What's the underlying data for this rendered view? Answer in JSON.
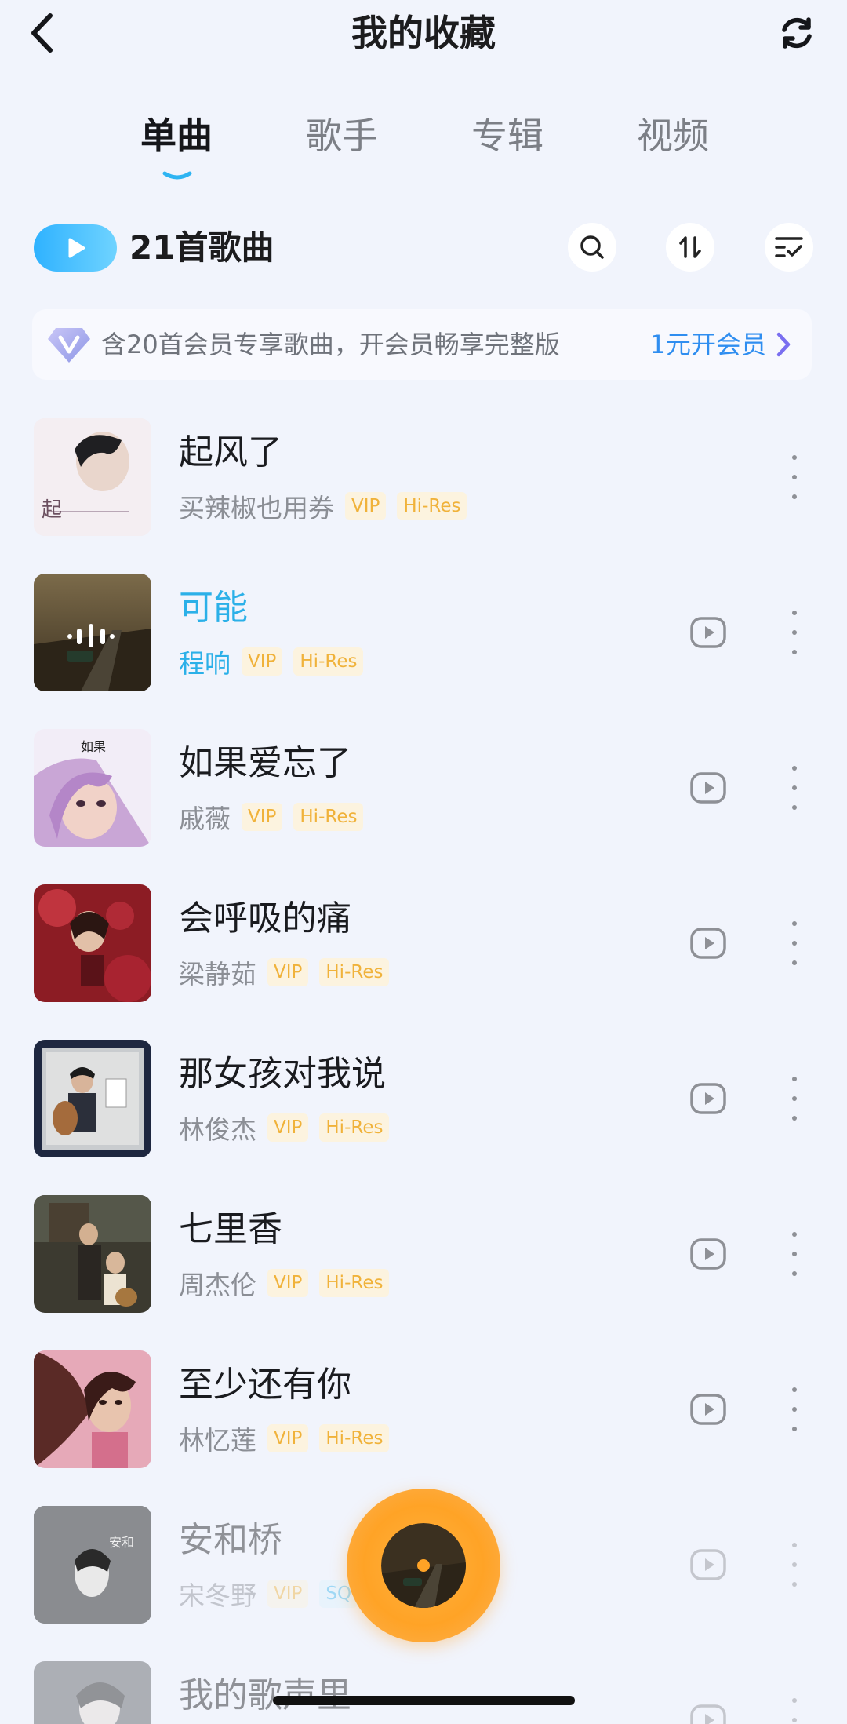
{
  "header": {
    "title": "我的收藏",
    "back_icon": "chevron-left-icon",
    "refresh_icon": "refresh-icon"
  },
  "tabs": [
    {
      "label": "单曲",
      "active": true
    },
    {
      "label": "歌手",
      "active": false
    },
    {
      "label": "专辑",
      "active": false
    },
    {
      "label": "视频",
      "active": false
    }
  ],
  "toolbar": {
    "song_count": "21首歌曲",
    "play_all_icon": "play-icon",
    "search_icon": "search-icon",
    "sort_icon": "sort-icon",
    "batch_icon": "multi-select-icon"
  },
  "vip_banner": {
    "text": "含20首会员专享歌曲，开会员畅享完整版",
    "cta": "1元开会员"
  },
  "songs": [
    {
      "title": "起风了",
      "artist": "买辣椒也用券",
      "tags": [
        "VIP",
        "Hi-Res"
      ],
      "playing": false
    },
    {
      "title": "可能",
      "artist": "程响",
      "tags": [
        "VIP",
        "Hi-Res"
      ],
      "playing": true
    },
    {
      "title": "如果爱忘了",
      "artist": "戚薇",
      "tags": [
        "VIP",
        "Hi-Res"
      ],
      "playing": false
    },
    {
      "title": "会呼吸的痛",
      "artist": "梁静茹",
      "tags": [
        "VIP",
        "Hi-Res"
      ],
      "playing": false
    },
    {
      "title": "那女孩对我说",
      "artist": "林俊杰",
      "tags": [
        "VIP",
        "Hi-Res"
      ],
      "playing": false
    },
    {
      "title": "七里香",
      "artist": "周杰伦",
      "tags": [
        "VIP",
        "Hi-Res"
      ],
      "playing": false
    },
    {
      "title": "至少还有你",
      "artist": "林忆莲",
      "tags": [
        "VIP",
        "Hi-Res"
      ],
      "playing": false
    },
    {
      "title": "安和桥",
      "artist": "宋冬野",
      "tags": [
        "VIP",
        "SQ"
      ],
      "playing": false
    },
    {
      "title": "我的歌声里",
      "artist": "",
      "tags": [],
      "playing": false
    }
  ],
  "colors": {
    "accent": "#2bb0e8",
    "vip_tag": "#f0b23a",
    "player": "#ffa326",
    "background": "#f1f4fc"
  }
}
